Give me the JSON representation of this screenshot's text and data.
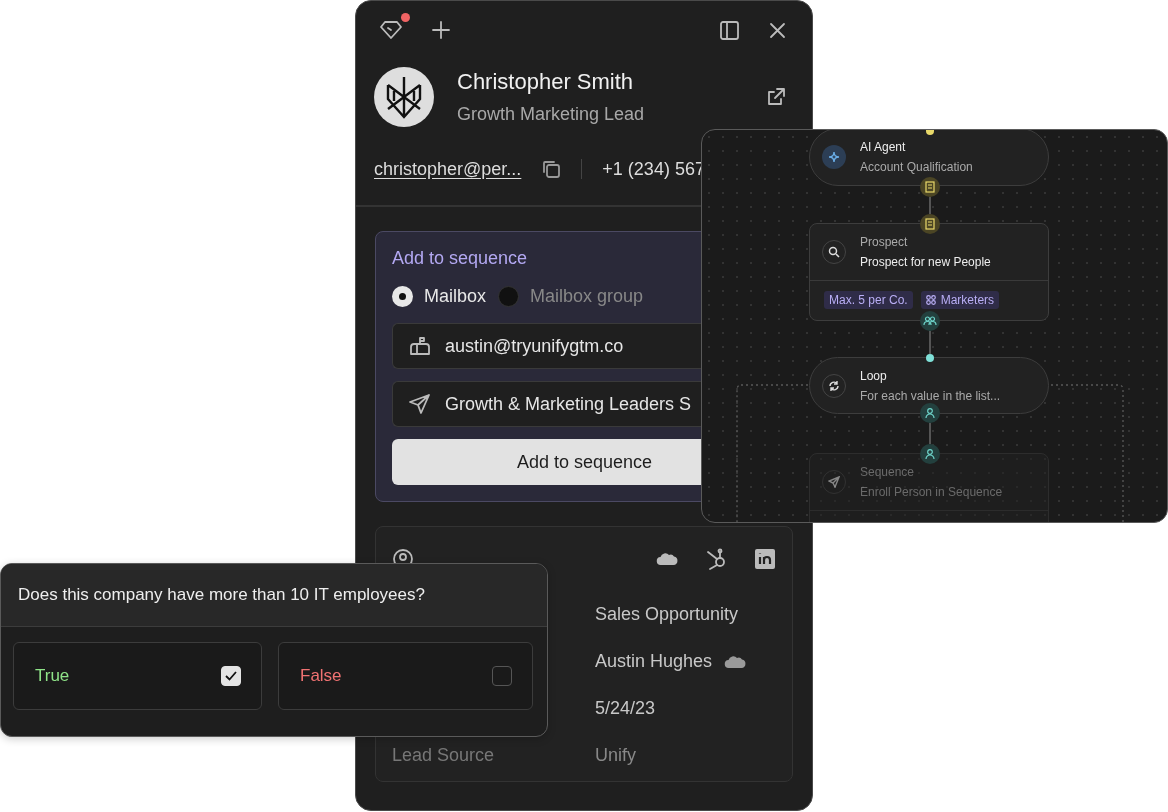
{
  "toolbar": {
    "notification": true
  },
  "contact": {
    "name": "Christopher Smith",
    "title": "Growth Marketing Lead",
    "email": "christopher@per...",
    "phone": "+1 (234) 567"
  },
  "add_to_sequence": {
    "title": "Add to sequence",
    "options": [
      {
        "label": "Mailbox",
        "selected": true
      },
      {
        "label": "Mailbox group",
        "selected": false
      }
    ],
    "mailbox": "austin@tryunifygtm.co",
    "sequence": "Growth & Marketing Leaders S",
    "button": "Add to sequence"
  },
  "person": {
    "fields": [
      {
        "kind": "text",
        "value": "Sales Opportunity"
      },
      {
        "kind": "owner",
        "value": "Austin Hughes"
      },
      {
        "kind": "text",
        "value": "5/24/23"
      },
      {
        "kind": "text",
        "label": "Lead Source",
        "value": "Unify"
      }
    ]
  },
  "workflow": {
    "nodes": [
      {
        "kind": "agent",
        "title": "AI Agent",
        "subtitle": "Account Qualification",
        "disabled": false
      },
      {
        "kind": "prospect",
        "title": "Prospect",
        "subtitle": "Prospect for new People",
        "disabled": false,
        "tags": [
          {
            "kind": "plain",
            "label": "Max. 5 per Co."
          },
          {
            "kind": "group",
            "label": "Marketers"
          }
        ]
      },
      {
        "kind": "loop",
        "title": "Loop",
        "subtitle": "For each value in the list...",
        "disabled": false
      },
      {
        "kind": "sequence",
        "title": "Sequence",
        "subtitle": "Enroll Person in Sequence",
        "disabled": true
      }
    ]
  },
  "question": {
    "text": "Does this company have more than 10 IT employees?",
    "answers": [
      {
        "label": "True",
        "checked": true,
        "color": "#8fe388"
      },
      {
        "label": "False",
        "checked": false,
        "color": "#f07272"
      }
    ]
  }
}
